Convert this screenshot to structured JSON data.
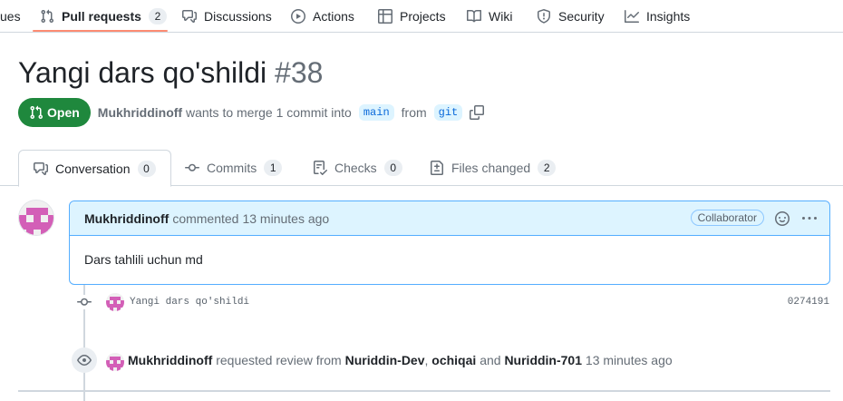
{
  "nav": {
    "partial_label": "ues",
    "items": [
      {
        "label": "Pull requests",
        "count": "2",
        "icon": "git-pull-request-icon"
      },
      {
        "label": "Discussions",
        "icon": "comment-discussion-icon"
      },
      {
        "label": "Actions",
        "icon": "play-icon"
      },
      {
        "label": "Projects",
        "icon": "table-icon"
      },
      {
        "label": "Wiki",
        "icon": "book-icon"
      },
      {
        "label": "Security",
        "icon": "shield-icon"
      },
      {
        "label": "Insights",
        "icon": "graph-icon"
      }
    ]
  },
  "pr": {
    "title": "Yangi dars qo'shildi",
    "number": "#38",
    "state": "Open",
    "author": "Mukhriddinoff",
    "merge_text": "wants to merge 1 commit into",
    "base_branch": "main",
    "from_text": "from",
    "head_branch": "git"
  },
  "tabs": [
    {
      "label": "Conversation",
      "count": "0",
      "icon": "comment-icon"
    },
    {
      "label": "Commits",
      "count": "1",
      "icon": "git-commit-icon"
    },
    {
      "label": "Checks",
      "count": "0",
      "icon": "checklist-icon"
    },
    {
      "label": "Files changed",
      "count": "2",
      "icon": "file-diff-icon"
    }
  ],
  "comment": {
    "author": "Mukhriddinoff",
    "action": "commented",
    "time": "13 minutes ago",
    "badge": "Collaborator",
    "body": "Dars tahlili uchun md"
  },
  "timeline": {
    "commit": {
      "message": "Yangi dars qo'shildi",
      "sha": "0274191"
    },
    "review": {
      "actor": "Mukhriddinoff",
      "action": "requested review from",
      "reviewer1": "Nuriddin-Dev",
      "separator": ",",
      "reviewer2": "ochiqai",
      "and_text": "and",
      "reviewer3": "Nuriddin-701",
      "time": "13 minutes ago"
    }
  },
  "colors": {
    "accent": "#fd8c73",
    "open_green": "#1f883d",
    "link_blue": "#0969da",
    "comment_head_bg": "#ddf4ff",
    "avatar_pink": "#d35fb7"
  }
}
